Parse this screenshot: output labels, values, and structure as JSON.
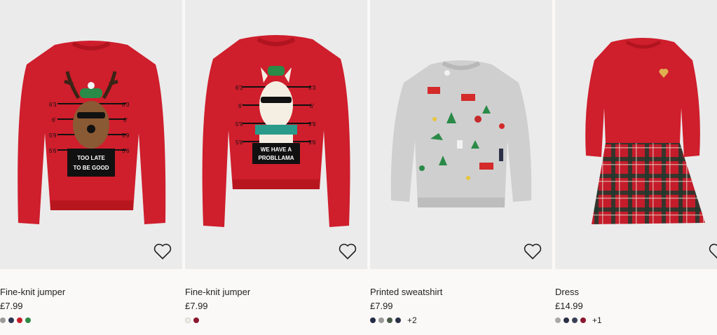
{
  "products": [
    {
      "name": "Fine-knit jumper",
      "price": "£7.99",
      "swatches": [
        "#9a9a9a",
        "#2e3550",
        "#c41c2a",
        "#2f8a45"
      ],
      "more": "",
      "image": "red-reindeer-jumper",
      "print_text": "TOO LATE TO BE GOOD",
      "heights": [
        "6'3",
        "6'",
        "5'9",
        "5'6",
        "6'3",
        "6'",
        "5'9",
        "5'6"
      ]
    },
    {
      "name": "Fine-knit jumper",
      "price": "£7.99",
      "swatches": [
        "#f2ede4",
        "#8a1830"
      ],
      "more": "",
      "image": "red-llama-jumper",
      "print_text": "WE HAVE A PROBLLAMA",
      "heights": [
        "6'3",
        "6'",
        "5'9",
        "5'6",
        "6'3",
        "6'",
        "5'9",
        "5'6"
      ]
    },
    {
      "name": "Printed sweatshirt",
      "price": "£7.99",
      "swatches": [
        "#252a45",
        "#9a9a9a",
        "#4a5a48",
        "#2b3048"
      ],
      "more": "+2",
      "image": "grey-christmas-print-sweatshirt"
    },
    {
      "name": "Dress",
      "price": "£14.99",
      "swatches": [
        "#a8a8a8",
        "#2b3048",
        "#3a3f55",
        "#8a1830"
      ],
      "more": "+1",
      "image": "red-tartan-dress"
    }
  ]
}
